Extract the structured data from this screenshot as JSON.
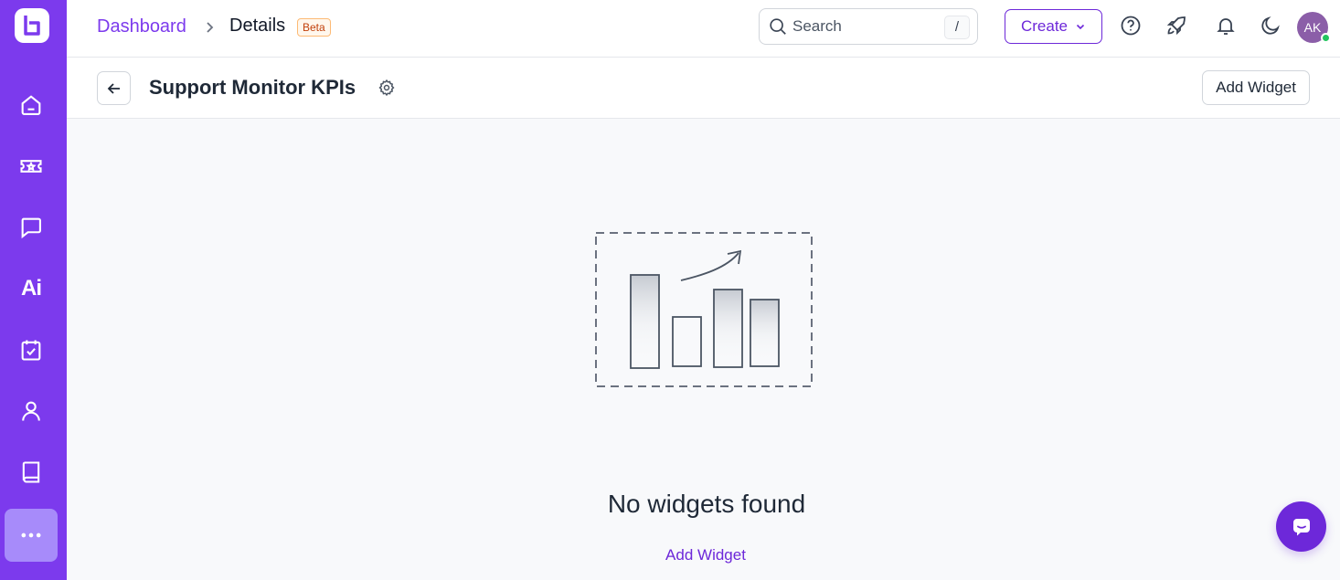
{
  "breadcrumb": {
    "root": "Dashboard",
    "current": "Details",
    "badge": "Beta"
  },
  "search": {
    "placeholder": "Search",
    "shortcut": "/"
  },
  "header": {
    "create_label": "Create",
    "avatar_initials": "AK"
  },
  "page": {
    "title": "Support Monitor KPIs",
    "add_widget_label": "Add Widget"
  },
  "empty_state": {
    "title": "No widgets found",
    "link_label": "Add Widget"
  },
  "sidebar": {
    "items": [
      {
        "icon": "home-icon"
      },
      {
        "icon": "ticket-icon"
      },
      {
        "icon": "chat-icon"
      },
      {
        "icon": "ai-icon",
        "label": "Ai"
      },
      {
        "icon": "task-icon"
      },
      {
        "icon": "user-icon"
      },
      {
        "icon": "book-icon"
      },
      {
        "icon": "more-icon"
      }
    ]
  },
  "colors": {
    "brand": "#7c3aed",
    "brand_dark": "#6d28d9",
    "active_nav": "#a78bfa",
    "online": "#22c55e"
  }
}
